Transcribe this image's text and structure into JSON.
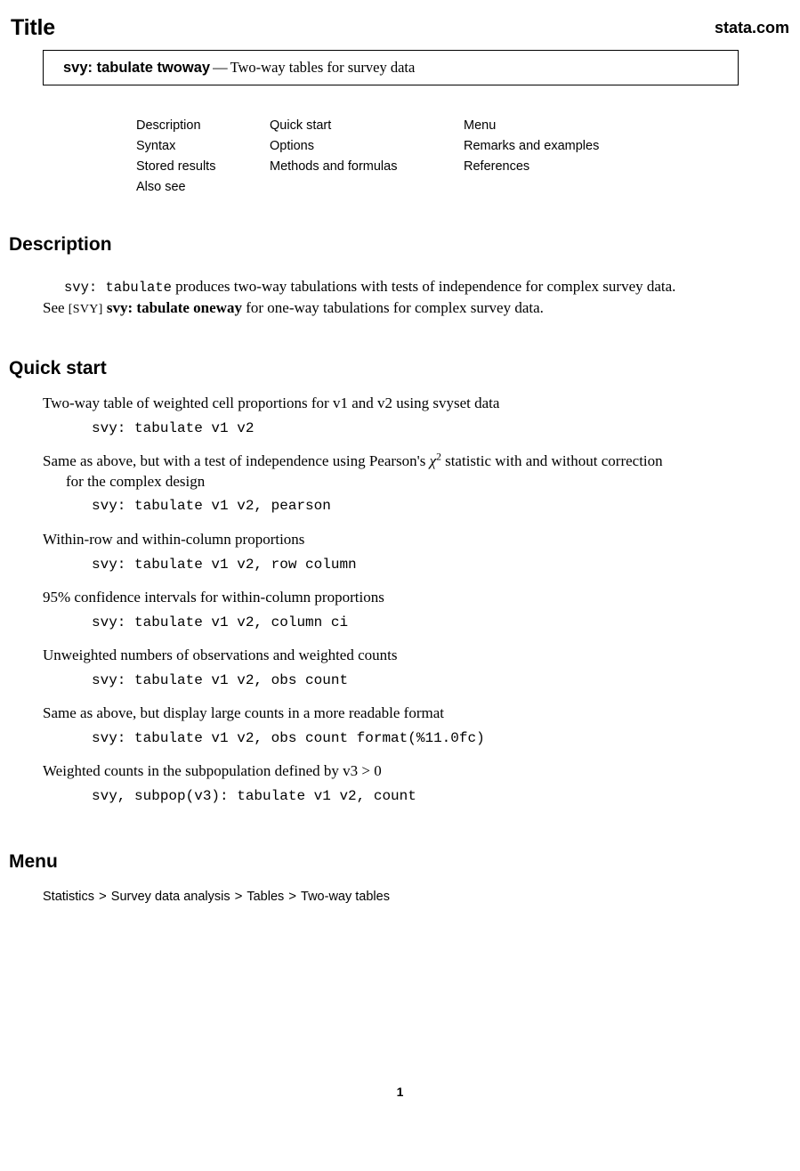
{
  "header": {
    "doc_kind": "Title",
    "site": "stata.com"
  },
  "title_box": {
    "command": "svy: tabulate twoway",
    "dash": "—",
    "description": "Two-way tables for survey data"
  },
  "nav": {
    "columns": [
      {
        "items": [
          "Description",
          "Syntax",
          "Stored results",
          "Also see"
        ]
      },
      {
        "items": [
          "Quick start",
          "Options",
          "Methods and formulas"
        ]
      },
      {
        "items": [
          "Menu",
          "Remarks and examples",
          "References"
        ]
      }
    ]
  },
  "sections": {
    "description": {
      "heading": "Description",
      "line1_cmd": "svy: tabulate",
      "line1_rest": " produces two-way tabulations with tests of independence for complex survey data.",
      "line2_see": "See ",
      "line2_manual": "[SVY]",
      "line2_xref": " svy: tabulate oneway",
      "line2_rest": " for one-way tabulations for complex survey data."
    },
    "quick_start": {
      "heading": "Quick start",
      "items": [
        {
          "text": "Two-way table of weighted cell proportions for v1 and v2 using svyset data",
          "code": "svy: tabulate v1 v2"
        },
        {
          "text_before_chi": "Same as above, but with a test of independence using Pearson's ",
          "chi": "χ",
          "chi_exp": "2",
          "text_after_chi": " statistic with and without correction",
          "text_cont": "for the complex design",
          "code": "svy: tabulate v1 v2, pearson"
        },
        {
          "text": "Within-row and within-column proportions",
          "code": "svy: tabulate v1 v2, row column"
        },
        {
          "text": "95% confidence intervals for within-column proportions",
          "code": "svy: tabulate v1 v2, column ci"
        },
        {
          "text": "Unweighted numbers of observations and weighted counts",
          "code": "svy: tabulate v1 v2, obs count"
        },
        {
          "text": "Same as above, but display large counts in a more readable format",
          "code": "svy: tabulate v1 v2, obs count format(%11.0fc)"
        },
        {
          "text": "Weighted counts in the subpopulation defined by v3 > 0",
          "code": "svy, subpop(v3): tabulate v1 v2, count"
        }
      ]
    },
    "menu": {
      "heading": "Menu",
      "breadcrumb": [
        "Statistics",
        "Survey data analysis",
        "Tables",
        "Two-way tables"
      ],
      "separator": ">"
    }
  },
  "footer": {
    "page_number": "1"
  }
}
